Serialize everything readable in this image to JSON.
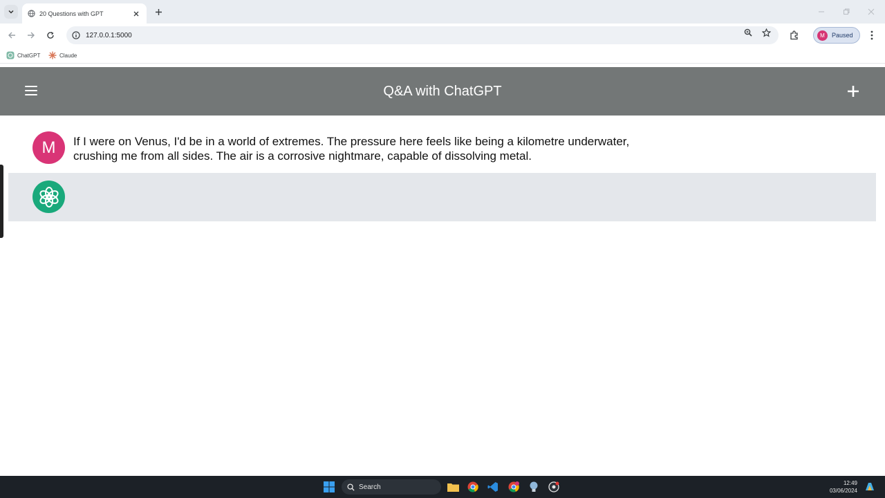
{
  "browser": {
    "tab_title": "20 Questions with GPT",
    "url": "127.0.0.1:5000",
    "profile_initial": "M",
    "profile_status": "Paused",
    "bookmarks": [
      {
        "label": "ChatGPT",
        "icon": "chatgpt-icon"
      },
      {
        "label": "Claude",
        "icon": "claude-icon"
      }
    ]
  },
  "app": {
    "title": "Q&A with ChatGPT",
    "messages": [
      {
        "role": "user",
        "avatar_letter": "M",
        "text": "If I were on Venus, I'd be in a world of extremes. The pressure here feels like being a kilometre underwater, crushing me from all sides. The air is a corrosive nightmare, capable of dissolving metal."
      },
      {
        "role": "assistant",
        "avatar_icon": "openai-logo-icon",
        "text": ""
      }
    ]
  },
  "taskbar": {
    "search_label": "Search",
    "time": "12:49",
    "date": "03/06/2024"
  },
  "colors": {
    "header_bg": "#737777",
    "user_avatar": "#d93476",
    "bot_avatar": "#19a97b",
    "bot_row_bg": "#e4e7eb"
  }
}
